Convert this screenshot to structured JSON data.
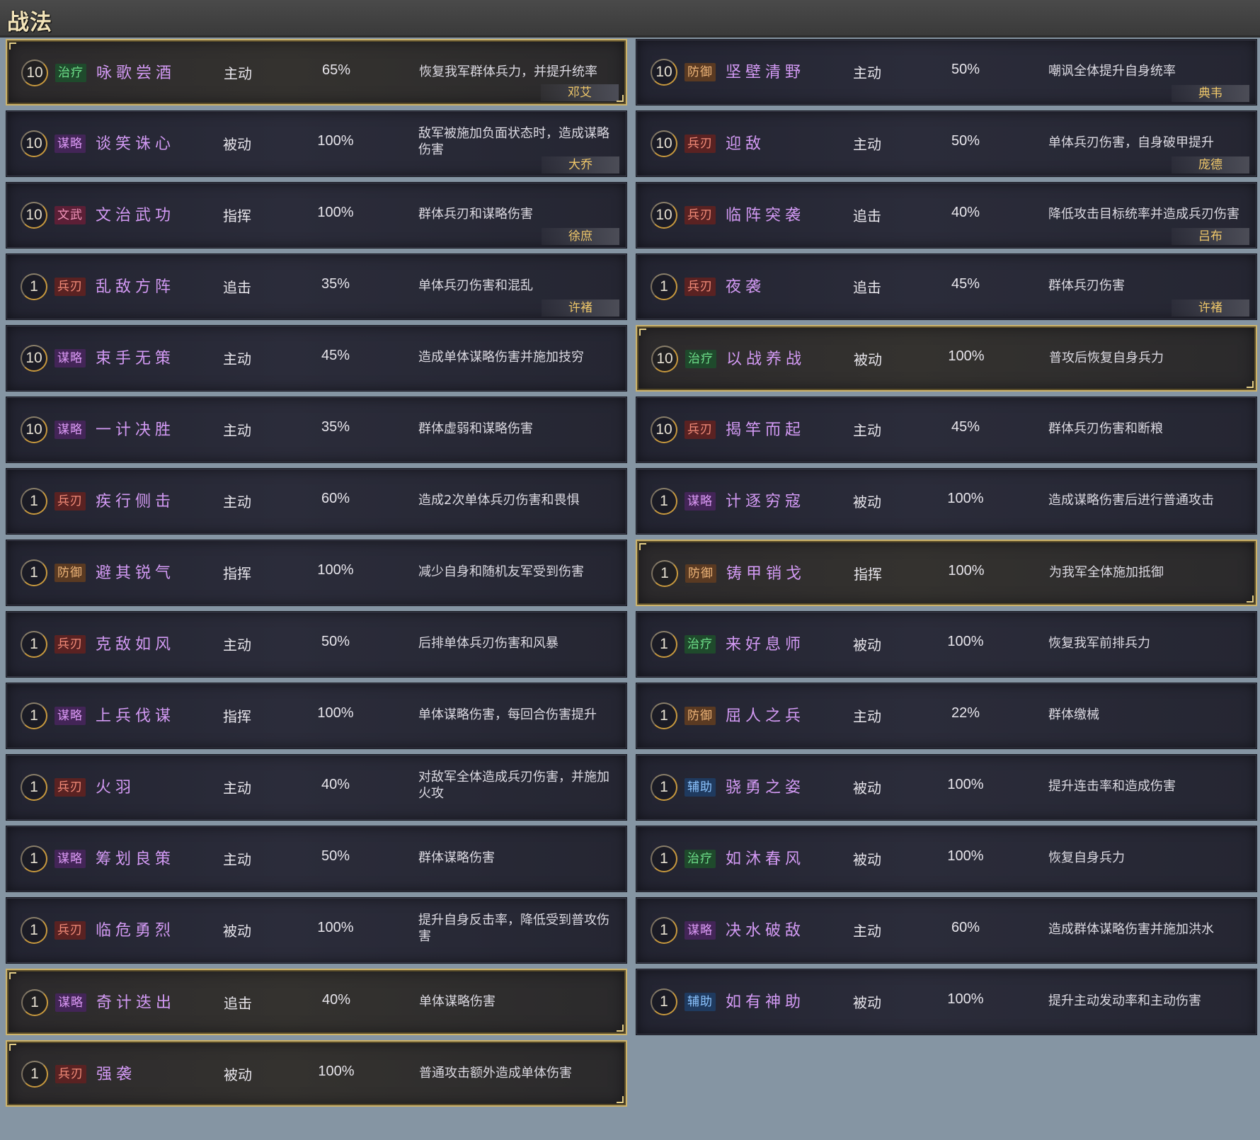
{
  "header": {
    "title": "战法"
  },
  "columns": [
    {
      "rows": [
        {
          "level": "10",
          "tag": "治疗",
          "tag_class": "heal",
          "name": "咏歌尝酒",
          "type": "主动",
          "rate": "65%",
          "desc": "恢复我军群体兵力，并提升统率",
          "owner": "邓艾",
          "gold": true
        },
        {
          "level": "10",
          "tag": "谋略",
          "tag_class": "strat",
          "name": "谈笑诛心",
          "type": "被动",
          "rate": "100%",
          "desc": "敌军被施加负面状态时，造成谋略伤害",
          "owner": "大乔",
          "gold": false
        },
        {
          "level": "10",
          "tag": "文武",
          "tag_class": "wenwu",
          "name": "文治武功",
          "type": "指挥",
          "rate": "100%",
          "desc": "群体兵刃和谋略伤害",
          "owner": "徐庶",
          "gold": false
        },
        {
          "level": "1",
          "tag": "兵刃",
          "tag_class": "blade",
          "name": "乱敌方阵",
          "type": "追击",
          "rate": "35%",
          "desc": "单体兵刃伤害和混乱",
          "owner": "许褚",
          "gold": false
        },
        {
          "level": "10",
          "tag": "谋略",
          "tag_class": "strat",
          "name": "束手无策",
          "type": "主动",
          "rate": "45%",
          "desc": "造成单体谋略伤害并施加技穷",
          "owner": "",
          "gold": false
        },
        {
          "level": "10",
          "tag": "谋略",
          "tag_class": "strat",
          "name": "一计决胜",
          "type": "主动",
          "rate": "35%",
          "desc": "群体虚弱和谋略伤害",
          "owner": "",
          "gold": false
        },
        {
          "level": "1",
          "tag": "兵刃",
          "tag_class": "blade",
          "name": "疾行侧击",
          "type": "主动",
          "rate": "60%",
          "desc": "造成2次单体兵刃伤害和畏惧",
          "owner": "",
          "gold": false
        },
        {
          "level": "1",
          "tag": "防御",
          "tag_class": "def",
          "name": "避其锐气",
          "type": "指挥",
          "rate": "100%",
          "desc": "减少自身和随机友军受到伤害",
          "owner": "",
          "gold": false
        },
        {
          "level": "1",
          "tag": "兵刃",
          "tag_class": "blade",
          "name": "克敌如风",
          "type": "主动",
          "rate": "50%",
          "desc": "后排单体兵刃伤害和风暴",
          "owner": "",
          "gold": false
        },
        {
          "level": "1",
          "tag": "谋略",
          "tag_class": "strat",
          "name": "上兵伐谋",
          "type": "指挥",
          "rate": "100%",
          "desc": "单体谋略伤害，每回合伤害提升",
          "owner": "",
          "gold": false
        },
        {
          "level": "1",
          "tag": "兵刃",
          "tag_class": "blade",
          "name": "火羽",
          "type": "主动",
          "rate": "40%",
          "desc": "对敌军全体造成兵刃伤害，并施加火攻",
          "owner": "",
          "gold": false
        },
        {
          "level": "1",
          "tag": "谋略",
          "tag_class": "strat",
          "name": "筹划良策",
          "type": "主动",
          "rate": "50%",
          "desc": "群体谋略伤害",
          "owner": "",
          "gold": false
        },
        {
          "level": "1",
          "tag": "兵刃",
          "tag_class": "blade",
          "name": "临危勇烈",
          "type": "被动",
          "rate": "100%",
          "desc": "提升自身反击率，降低受到普攻伤害",
          "owner": "",
          "gold": false
        },
        {
          "level": "1",
          "tag": "谋略",
          "tag_class": "strat",
          "name": "奇计迭出",
          "type": "追击",
          "rate": "40%",
          "desc": "单体谋略伤害",
          "owner": "",
          "gold": true
        },
        {
          "level": "1",
          "tag": "兵刃",
          "tag_class": "blade",
          "name": "强袭",
          "type": "被动",
          "rate": "100%",
          "desc": "普通攻击额外造成单体伤害",
          "owner": "",
          "gold": true
        }
      ]
    },
    {
      "rows": [
        {
          "level": "10",
          "tag": "防御",
          "tag_class": "def",
          "name": "坚壁清野",
          "type": "主动",
          "rate": "50%",
          "desc": "嘲讽全体提升自身统率",
          "owner": "典韦",
          "gold": false
        },
        {
          "level": "10",
          "tag": "兵刃",
          "tag_class": "blade",
          "name": "迎敌",
          "type": "主动",
          "rate": "50%",
          "desc": "单体兵刃伤害，自身破甲提升",
          "owner": "庞德",
          "gold": false
        },
        {
          "level": "10",
          "tag": "兵刃",
          "tag_class": "blade",
          "name": "临阵突袭",
          "type": "追击",
          "rate": "40%",
          "desc": "降低攻击目标统率并造成兵刃伤害",
          "owner": "吕布",
          "gold": false
        },
        {
          "level": "1",
          "tag": "兵刃",
          "tag_class": "blade",
          "name": "夜袭",
          "type": "追击",
          "rate": "45%",
          "desc": "群体兵刃伤害",
          "owner": "许褚",
          "gold": false
        },
        {
          "level": "10",
          "tag": "治疗",
          "tag_class": "heal",
          "name": "以战养战",
          "type": "被动",
          "rate": "100%",
          "desc": "普攻后恢复自身兵力",
          "owner": "",
          "gold": true
        },
        {
          "level": "10",
          "tag": "兵刃",
          "tag_class": "blade",
          "name": "揭竿而起",
          "type": "主动",
          "rate": "45%",
          "desc": "群体兵刃伤害和断粮",
          "owner": "",
          "gold": false
        },
        {
          "level": "1",
          "tag": "谋略",
          "tag_class": "strat",
          "name": "计逐穷寇",
          "type": "被动",
          "rate": "100%",
          "desc": "造成谋略伤害后进行普通攻击",
          "owner": "",
          "gold": false
        },
        {
          "level": "1",
          "tag": "防御",
          "tag_class": "def",
          "name": "铸甲销戈",
          "type": "指挥",
          "rate": "100%",
          "desc": "为我军全体施加抵御",
          "owner": "",
          "gold": true
        },
        {
          "level": "1",
          "tag": "治疗",
          "tag_class": "heal",
          "name": "来好息师",
          "type": "被动",
          "rate": "100%",
          "desc": "恢复我军前排兵力",
          "owner": "",
          "gold": false
        },
        {
          "level": "1",
          "tag": "防御",
          "tag_class": "def",
          "name": "屈人之兵",
          "type": "主动",
          "rate": "22%",
          "desc": "群体缴械",
          "owner": "",
          "gold": false
        },
        {
          "level": "1",
          "tag": "辅助",
          "tag_class": "assist",
          "name": "骁勇之姿",
          "type": "被动",
          "rate": "100%",
          "desc": "提升连击率和造成伤害",
          "owner": "",
          "gold": false
        },
        {
          "level": "1",
          "tag": "治疗",
          "tag_class": "heal",
          "name": "如沐春风",
          "type": "被动",
          "rate": "100%",
          "desc": "恢复自身兵力",
          "owner": "",
          "gold": false
        },
        {
          "level": "1",
          "tag": "谋略",
          "tag_class": "strat",
          "name": "决水破敌",
          "type": "主动",
          "rate": "60%",
          "desc": "造成群体谋略伤害并施加洪水",
          "owner": "",
          "gold": false
        },
        {
          "level": "1",
          "tag": "辅助",
          "tag_class": "assist",
          "name": "如有神助",
          "type": "被动",
          "rate": "100%",
          "desc": "提升主动发动率和主动伤害",
          "owner": "",
          "gold": false
        }
      ]
    }
  ]
}
